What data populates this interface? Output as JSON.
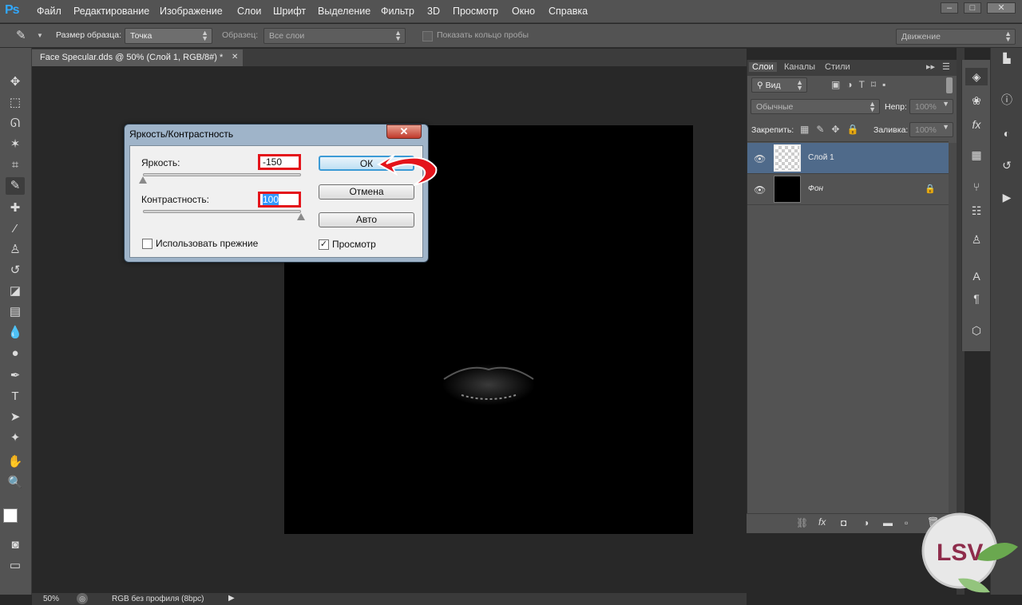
{
  "app": {
    "logo": "Ps"
  },
  "menu": [
    "Файл",
    "Редактирование",
    "Изображение",
    "Слои",
    "Шрифт",
    "Выделение",
    "Фильтр",
    "3D",
    "Просмотр",
    "Окно",
    "Справка"
  ],
  "window_controls": [
    "–",
    "□",
    "✕"
  ],
  "options": {
    "sample_size_label": "Размер образца:",
    "sample_size_value": "Точка",
    "sample_label": "Образец:",
    "sample_value": "Все слои",
    "show_ring": "Показать кольцо пробы",
    "workspace": "Движение"
  },
  "document": {
    "tab_title": "Face Specular.dds @ 50% (Слой 1, RGB/8#) *",
    "tab_close": "✕"
  },
  "status": {
    "zoom": "50%",
    "profile": "RGB без профиля (8bpc)"
  },
  "layers_panel": {
    "tabs": [
      "Слои",
      "Каналы",
      "Стили"
    ],
    "filter": "Вид",
    "blend_mode": "Обычные",
    "opacity_label": "Непр:",
    "opacity_value": "100%",
    "lock_label": "Закрепить:",
    "fill_label": "Заливка:",
    "fill_value": "100%",
    "layers": [
      {
        "name": "Слой 1",
        "selected": true
      },
      {
        "name": "Фон",
        "selected": false,
        "locked": true
      }
    ]
  },
  "dialog": {
    "title": "Яркость/Контрастность",
    "close": "✕",
    "brightness_label": "Яркость:",
    "brightness_value": "-150",
    "contrast_label": "Контрастность:",
    "contrast_value": "100",
    "ok_label": "ОК",
    "cancel_label": "Отмена",
    "auto_label": "Авто",
    "legacy_label": "Использовать прежние",
    "legacy_checked": false,
    "preview_label": "Просмотр",
    "preview_checked": true,
    "brightness_slider_fraction": 0.0,
    "contrast_slider_fraction": 1.0
  },
  "colors": {
    "accent_red": "#e4141b",
    "selected_layer": "#4f6a8a"
  },
  "watermark": {
    "text": "LSV"
  }
}
